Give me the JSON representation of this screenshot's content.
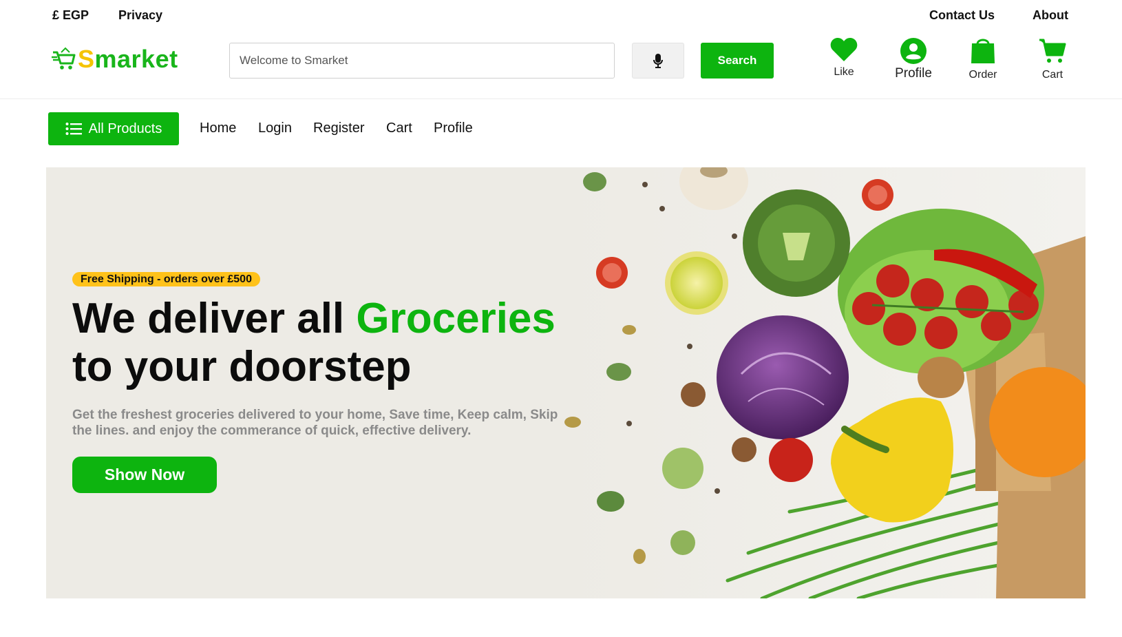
{
  "topbar": {
    "currency": "£ EGP",
    "privacy": "Privacy",
    "contact": "Contact Us",
    "about": "About"
  },
  "header": {
    "logo_prefix": "S",
    "logo_rest": "market",
    "search": {
      "placeholder": "Welcome to Smarket",
      "button": "Search"
    },
    "icons": {
      "like": "Like",
      "profile": "Profile",
      "order": "Order",
      "cart": "Cart"
    }
  },
  "nav": {
    "all_products": "All Products",
    "links": [
      "Home",
      "Login",
      "Register",
      "Cart",
      "Profile"
    ]
  },
  "hero": {
    "badge": "Free Shipping - orders over £500",
    "headline_part1": "We deliver all ",
    "headline_highlight": "Groceries",
    "headline_line2": "to your doorstep",
    "description": "Get the freshest groceries delivered to your home, Save time, Keep calm, Skip the lines. and enjoy the commerance of quick, effective delivery.",
    "cta": "Show Now"
  },
  "colors": {
    "brand_green": "#0db40f",
    "brand_yellow": "#f5c400",
    "badge_yellow": "#ffc21a",
    "hero_bg": "#edebe5"
  }
}
